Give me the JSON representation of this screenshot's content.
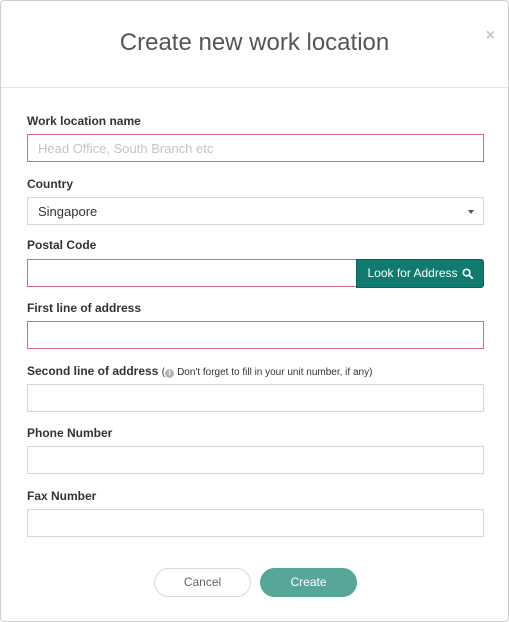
{
  "dialog": {
    "title": "Create new work location",
    "close_glyph": "×"
  },
  "form": {
    "name_label": "Work location name",
    "name_placeholder": "Head Office, South Branch etc",
    "name_value": "",
    "country_label": "Country",
    "country_value": "Singapore",
    "postal_label": "Postal Code",
    "postal_value": "",
    "lookup_button": "Look for Address",
    "address1_label": "First line of address",
    "address1_value": "",
    "address2_label": "Second line of address",
    "address2_hint_open": "(",
    "address2_hint_icon": "i",
    "address2_hint": "Don't forget to fill in your unit number, if any)",
    "address2_value": "",
    "phone_label": "Phone Number",
    "phone_value": "",
    "fax_label": "Fax Number",
    "fax_value": ""
  },
  "actions": {
    "cancel": "Cancel",
    "create": "Create"
  },
  "colors": {
    "primary": "#0f7a6f",
    "create_button": "#56a79a",
    "invalid_border": "#d56a7e"
  },
  "icons": {
    "close": "close-icon",
    "search": "search-icon",
    "info": "info-icon",
    "caret": "chevron-down-icon"
  }
}
